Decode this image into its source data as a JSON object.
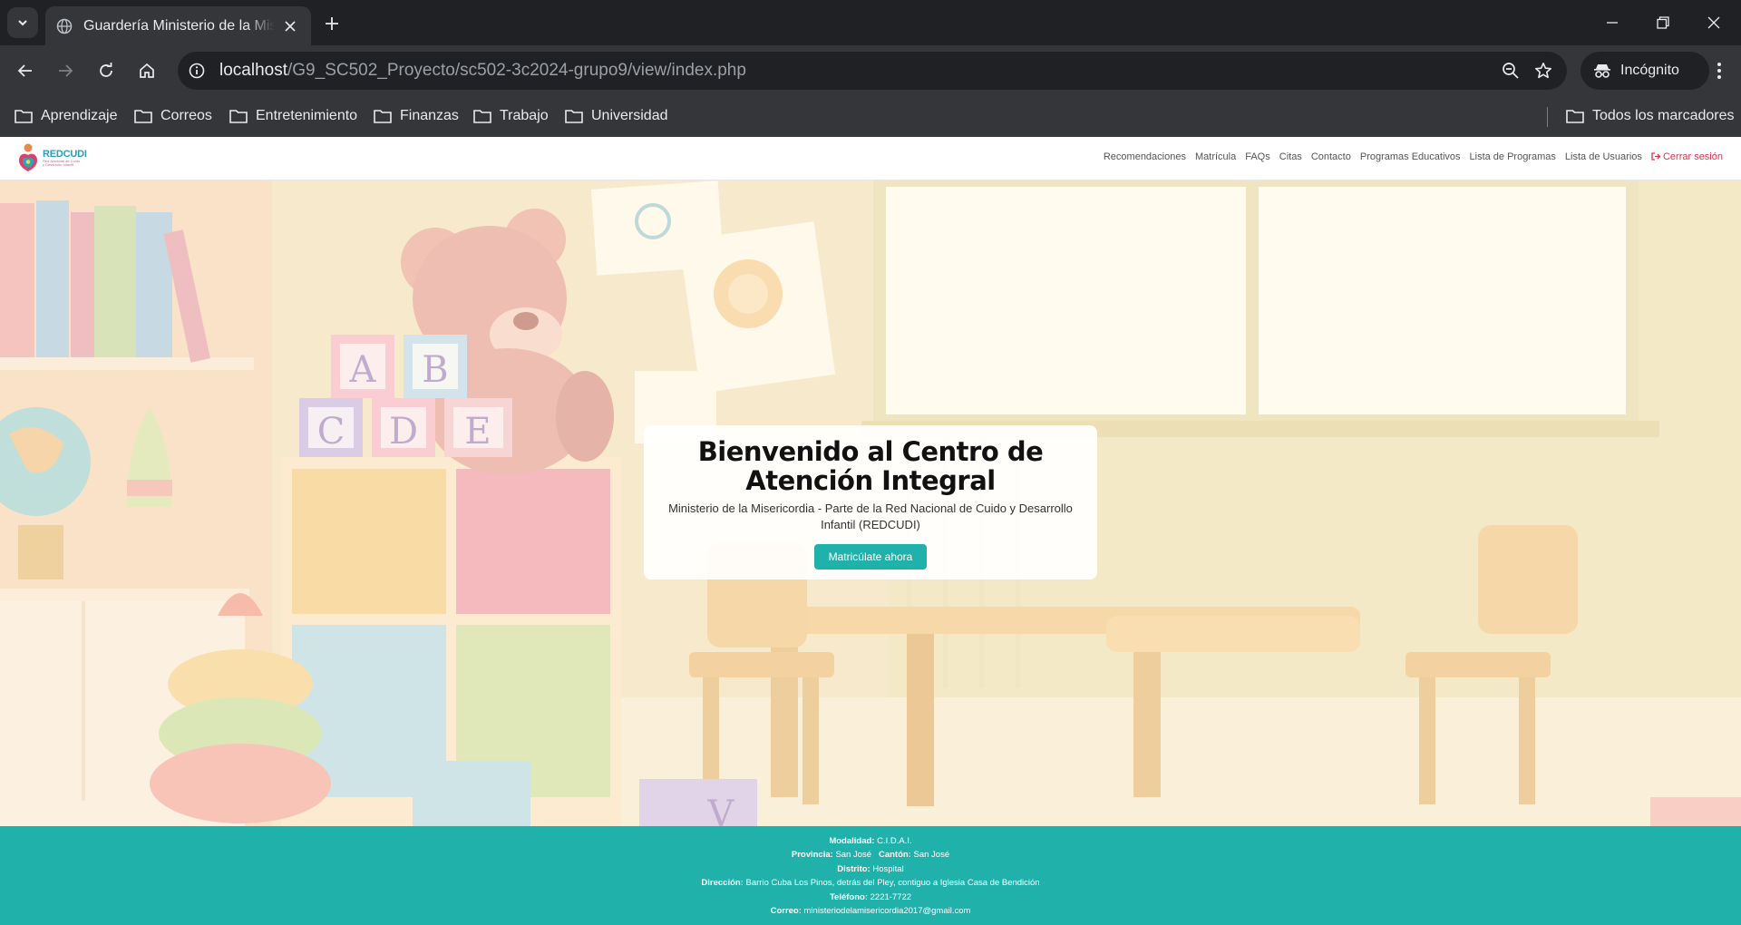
{
  "browser": {
    "tab_title": "Guardería Ministerio de la Misericordia",
    "url_host": "localhost",
    "url_path": "/G9_SC502_Proyecto/sc502-3c2024-grupo9/view/index.php",
    "profile_label": "Incógnito",
    "bookmarks": [
      "Aprendizaje",
      "Correos",
      "Entretenimiento",
      "Finanzas",
      "Trabajo",
      "Universidad"
    ],
    "all_bookmarks": "Todos los marcadores"
  },
  "site": {
    "logo_name": "REDCUDI",
    "logo_sub": "Red Nacional de Cuido y Desarrollo Infantil",
    "menu": [
      "Recomendaciones",
      "Matrícula",
      "FAQs",
      "Citas",
      "Contacto",
      "Programas Educativos",
      "Lista de Programas",
      "Lista de Usuarios"
    ],
    "logout": "Cerrar sesión"
  },
  "hero": {
    "title": "Bienvenido al Centro de Atención Integral",
    "subtitle": "Ministerio de la Misericordia - Parte de la Red Nacional de Cuido y Desarrollo Infantil (REDCUDI)",
    "cta": "Matricúlate ahora",
    "block_letters": [
      "A",
      "B",
      "C",
      "D",
      "E",
      "V"
    ]
  },
  "footer": {
    "modalidad_label": "Modalidad:",
    "modalidad": "C.I.D.A.I.",
    "provincia_label": "Provincia:",
    "provincia": "San José",
    "canton_label": "Cantón:",
    "canton": "San José",
    "distrito_label": "Distrito:",
    "distrito": "Hospital",
    "direccion_label": "Dirección:",
    "direccion": "Barrio Cuba Los Pinos, detrás del Pley, contiguo a Iglesia Casa de Bendición",
    "telefono_label": "Teléfono:",
    "telefono": "2221-7722",
    "correo_label": "Correo:",
    "correo": "ministeriodelamisericordia2017@gmail.com"
  },
  "colors": {
    "accent": "#20b2aa",
    "logout": "#dc3545",
    "chrome_dark": "#202124",
    "chrome": "#35363a"
  }
}
